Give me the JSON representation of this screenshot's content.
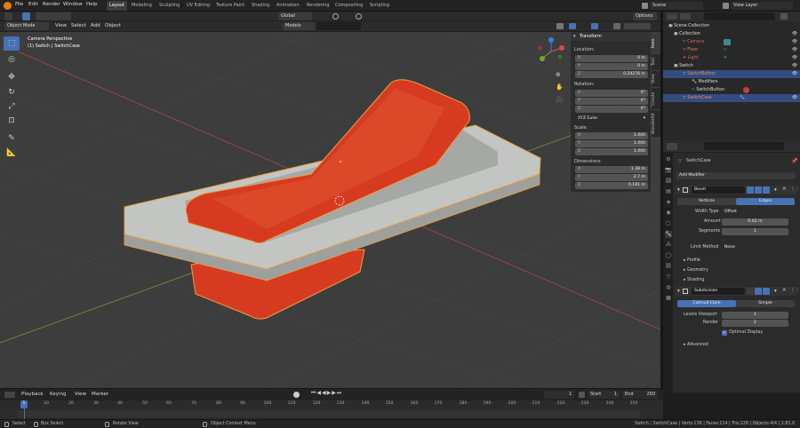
{
  "top_menu": [
    "File",
    "Edit",
    "Render",
    "Window",
    "Help"
  ],
  "workspaces": [
    "Layout",
    "Modeling",
    "Sculpting",
    "UV Editing",
    "Texture Paint",
    "Shading",
    "Animation",
    "Rendering",
    "Compositing",
    "Scripting"
  ],
  "scene": "Scene",
  "view_layer": "View Layer",
  "viewport": {
    "mode": "Object Mode",
    "menus": [
      "View",
      "Select",
      "Add",
      "Object"
    ],
    "orientation": "Global",
    "options": "Options",
    "models_label": "Models",
    "overlay_title": "Camera Perspective",
    "overlay_sub": "(1) Switch | SwitchCase"
  },
  "npanel": {
    "header": "Transform",
    "location_label": "Location:",
    "location": [
      {
        "k": "X",
        "v": "0 m"
      },
      {
        "k": "Y",
        "v": "0 m"
      },
      {
        "k": "Z",
        "v": "0.29276 m"
      }
    ],
    "rotation_label": "Rotation:",
    "rotation": [
      {
        "k": "X",
        "v": "0°"
      },
      {
        "k": "Y",
        "v": "0°"
      },
      {
        "k": "Z",
        "v": "0°"
      }
    ],
    "rotation_mode": "XYZ Euler",
    "scale_label": "Scale:",
    "scale": [
      {
        "k": "X",
        "v": "1.000"
      },
      {
        "k": "Y",
        "v": "1.000"
      },
      {
        "k": "Z",
        "v": "1.000"
      }
    ],
    "dimensions_label": "Dimensions:",
    "dimensions": [
      {
        "k": "X",
        "v": "1.38 m"
      },
      {
        "k": "Y",
        "v": "2.7 m"
      },
      {
        "k": "Z",
        "v": "0.181 m"
      }
    ],
    "tabs": [
      "Item",
      "Tool",
      "View",
      "Create",
      "BlenderKit"
    ]
  },
  "outliner": {
    "rows": [
      {
        "label": "Scene Collection"
      },
      {
        "label": "Collection"
      },
      {
        "label": "Camera"
      },
      {
        "label": "Floor"
      },
      {
        "label": "Light"
      },
      {
        "label": "Switch"
      },
      {
        "label": "SwitchButton"
      },
      {
        "label": "Modifiers"
      },
      {
        "label": "SwitchButton"
      },
      {
        "label": "SwitchCase"
      }
    ]
  },
  "properties": {
    "object_name": "SwitchCase",
    "add_modifier": "Add Modifier",
    "bevel": {
      "name": "Bevel",
      "tab_vertices": "Vertices",
      "tab_edges": "Edges",
      "width_type_label": "Width Type",
      "width_type": "Offset",
      "amount_label": "Amount",
      "amount": "0.02 m",
      "segments_label": "Segments",
      "segments": "1",
      "limit_method_label": "Limit Method",
      "limit_method": "None",
      "subpanels": [
        "Profile",
        "Geometry",
        "Shading"
      ]
    },
    "subdivision": {
      "name": "Subdivision",
      "tab_catmull": "Catmull-Clark",
      "tab_simple": "Simple",
      "levels_viewport_label": "Levels Viewport",
      "levels_viewport": "1",
      "render_label": "Render",
      "render": "2",
      "optimal_display": "Optimal Display",
      "advanced": "Advanced"
    }
  },
  "timeline": {
    "menus": [
      "Playback",
      "Keying",
      "View",
      "Marker"
    ],
    "current_frame": "1",
    "start_label": "Start",
    "start": "1",
    "end_label": "End",
    "end": "250",
    "ticks": [
      "1",
      "10",
      "20",
      "30",
      "40",
      "50",
      "60",
      "70",
      "80",
      "90",
      "100",
      "110",
      "120",
      "130",
      "140",
      "150",
      "160",
      "170",
      "180",
      "190",
      "200",
      "210",
      "220",
      "230",
      "240",
      "250"
    ]
  },
  "status": {
    "select": "Select",
    "box_select": "Box Select",
    "rotate_view": "Rotate View",
    "context_menu": "Object Context Menu",
    "stats": "Switch | SwitchCase | Verts:136 | Faces:114 | Tris:228 | Objects:4/4 | 2.81.0"
  },
  "colors": {
    "accent": "#4772b3",
    "selection_orange": "#f0a040",
    "button_red": "#d63b22",
    "case_grey": "#c6c8c6",
    "viewport_bg": "#3d3d3d"
  }
}
